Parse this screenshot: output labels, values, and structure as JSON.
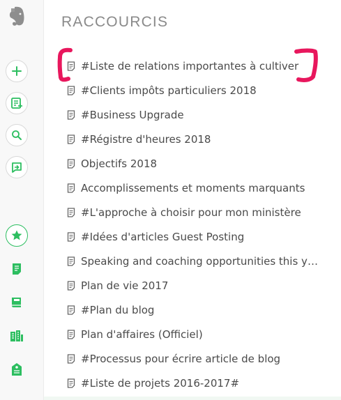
{
  "app": {
    "title": "RACCOURCIS",
    "accent_color": "#2dbe60",
    "annotation_color": "#e8175d"
  },
  "sidebar": {
    "buttons": [
      {
        "name": "new-note",
        "icon": "plus-icon"
      },
      {
        "name": "work-chat",
        "icon": "note-plus-icon"
      },
      {
        "name": "search",
        "icon": "search-icon"
      },
      {
        "name": "share",
        "icon": "share-icon"
      },
      {
        "name": "shortcuts",
        "icon": "star-icon",
        "active": true
      },
      {
        "name": "notes",
        "icon": "note-icon"
      },
      {
        "name": "notebooks",
        "icon": "notebook-icon"
      },
      {
        "name": "work",
        "icon": "building-icon"
      },
      {
        "name": "tags",
        "icon": "tag-icon"
      }
    ]
  },
  "shortcuts": {
    "items": [
      {
        "label": "#Liste de relations importantes à cultiver"
      },
      {
        "label": "#Clients impôts particuliers 2018"
      },
      {
        "label": "#Business Upgrade"
      },
      {
        "label": "#Régistre d'heures 2018"
      },
      {
        "label": "Objectifs 2018"
      },
      {
        "label": "Accomplissements et moments marquants"
      },
      {
        "label": "#L'approche à choisir pour mon ministère"
      },
      {
        "label": "#Idées d'articles Guest Posting"
      },
      {
        "label": "Speaking and coaching opportunities this year"
      },
      {
        "label": "Plan de vie 2017"
      },
      {
        "label": "#Plan du blog"
      },
      {
        "label": "Plan d'affaires (Officiel)"
      },
      {
        "label": "#Processus pour écrire article de blog"
      },
      {
        "label": "#Liste de projets 2016-2017#"
      }
    ]
  }
}
